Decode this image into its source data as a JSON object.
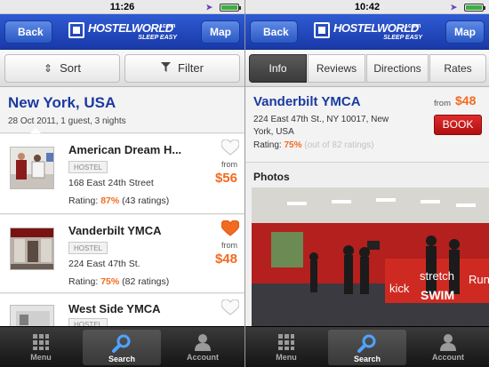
{
  "left": {
    "status": {
      "time": "11:26"
    },
    "nav": {
      "back_label": "Back",
      "map_label": "Map",
      "logo_word": "HOSTELWORLD",
      "logo_dotcom": ".com",
      "logo_tagline": "SLEEP EASY"
    },
    "toolbar": {
      "sort_label": "Sort",
      "filter_label": "Filter"
    },
    "city": {
      "name": "New York, USA",
      "subtitle": "28 Oct 2011, 1 guest, 3 nights"
    },
    "listings": [
      {
        "name": "American Dream H...",
        "type": "HOSTEL",
        "address": "168 East 24th Street",
        "rating_label": "Rating:",
        "rating_pct": "87%",
        "rating_count": "(43 ratings)",
        "from_label": "from",
        "price": "$56",
        "favorite": false
      },
      {
        "name": "Vanderbilt YMCA",
        "type": "HOSTEL",
        "address": "224 East 47th St.",
        "rating_label": "Rating:",
        "rating_pct": "75%",
        "rating_count": "(82 ratings)",
        "from_label": "from",
        "price": "$48",
        "favorite": true
      },
      {
        "name": "West Side YMCA",
        "type": "HOSTEL",
        "favorite": false
      }
    ]
  },
  "right": {
    "status": {
      "time": "10:42"
    },
    "nav": {
      "back_label": "Back",
      "map_label": "Map",
      "logo_word": "HOSTELWORLD",
      "logo_dotcom": ".com",
      "logo_tagline": "SLEEP EASY"
    },
    "tabs": [
      {
        "label": "Info",
        "active": true
      },
      {
        "label": "Reviews",
        "active": false
      },
      {
        "label": "Directions",
        "active": false
      },
      {
        "label": "Rates",
        "active": false
      }
    ],
    "detail": {
      "name": "Vanderbilt YMCA",
      "address": "224 East 47th St., NY 10017, New York, USA",
      "rating_label": "Rating:",
      "rating_pct": "75%",
      "rating_count": "(out of 82 ratings)",
      "from_label": "from",
      "price": "$48",
      "book_label": "BOOK"
    },
    "photos": {
      "title": "Photos",
      "sign_words": [
        "kick",
        "stretch",
        "SWIM",
        "Run"
      ]
    }
  },
  "tabbar": {
    "menu_label": "Menu",
    "search_label": "Search",
    "account_label": "Account"
  },
  "colors": {
    "nav_blue": "#1f45b8",
    "title_blue": "#1a3aa0",
    "accent_orange": "#f36b20",
    "book_red": "#c41a1a",
    "heart_orange": "#f36b20"
  }
}
